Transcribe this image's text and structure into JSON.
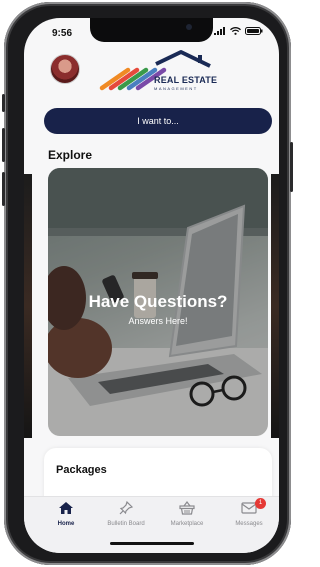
{
  "status": {
    "time": "9:56"
  },
  "header": {
    "logo_title": "REAL ESTATE",
    "logo_subtitle": "MANAGEMENT"
  },
  "actions": {
    "want_label": "I want to..."
  },
  "explore": {
    "title": "Explore",
    "card": {
      "title": "Have Questions?",
      "subtitle": "Answers Here!"
    }
  },
  "packages": {
    "title": "Packages"
  },
  "tabbar": {
    "items": [
      {
        "label": "Home",
        "icon": "home-icon",
        "active": true
      },
      {
        "label": "Bulletin Board",
        "icon": "pin-icon",
        "active": false
      },
      {
        "label": "Marketplace",
        "icon": "basket-icon",
        "active": false
      },
      {
        "label": "Messages",
        "icon": "envelope-icon",
        "active": false,
        "badge": "1"
      }
    ]
  },
  "colors": {
    "navy": "#18224a",
    "badge": "#e53935"
  }
}
